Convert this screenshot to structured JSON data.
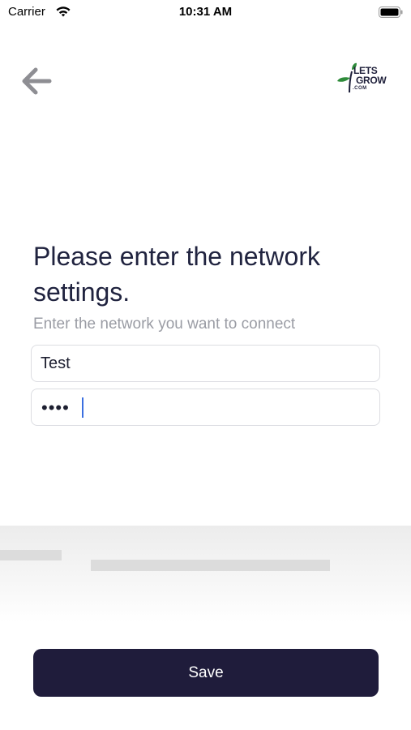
{
  "status_bar": {
    "carrier": "Carrier",
    "time": "10:31 AM",
    "wifi_icon": "wifi-icon",
    "battery_icon": "battery-icon"
  },
  "header": {
    "back_icon": "arrow-left-icon",
    "logo": {
      "line1": "LETS",
      "line2": "GROW",
      "line3": ".COM",
      "color": "#1e1f3a",
      "accent_color": "#2e8b3a"
    }
  },
  "main": {
    "title": "Please enter the network settings.",
    "subtitle": "Enter the network you want to connect",
    "network_field": {
      "value": "Test",
      "placeholder": ""
    },
    "password_field": {
      "value": "••••",
      "placeholder": ""
    }
  },
  "footer": {
    "save_label": "Save",
    "button_color": "#1f1c3b"
  }
}
